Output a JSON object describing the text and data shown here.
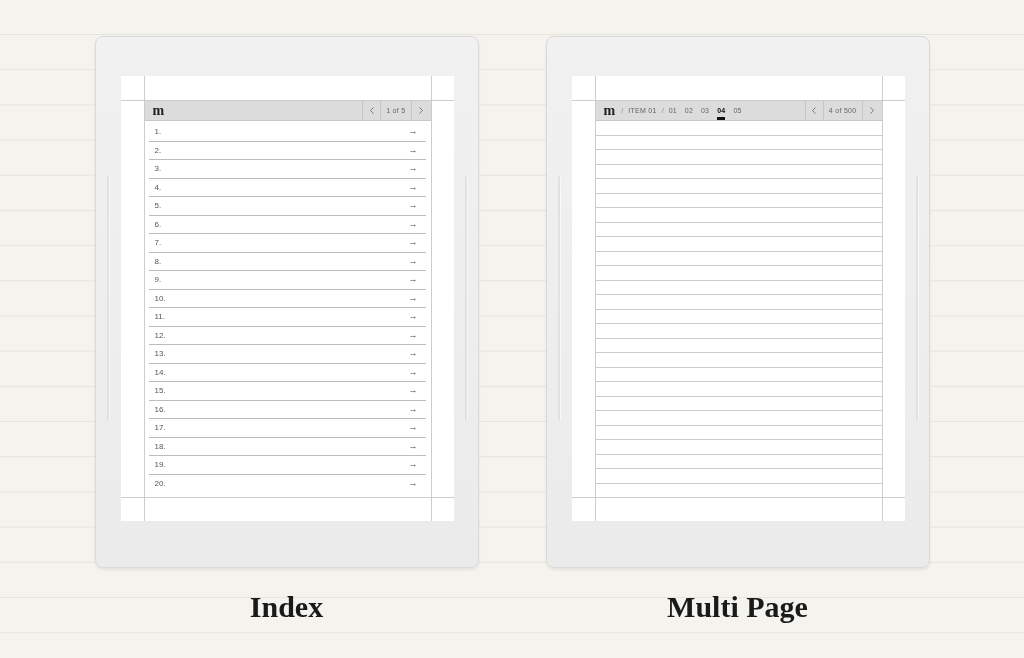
{
  "devices": [
    {
      "kind": "index",
      "header": {
        "logo": "m",
        "page_counter": "1 of 5"
      },
      "rows": [
        {
          "number": "1.",
          "arrow": "→"
        },
        {
          "number": "2.",
          "arrow": "→"
        },
        {
          "number": "3.",
          "arrow": "→"
        },
        {
          "number": "4.",
          "arrow": "→"
        },
        {
          "number": "5.",
          "arrow": "→"
        },
        {
          "number": "6.",
          "arrow": "→"
        },
        {
          "number": "7.",
          "arrow": "→"
        },
        {
          "number": "8.",
          "arrow": "→"
        },
        {
          "number": "9.",
          "arrow": "→"
        },
        {
          "number": "10.",
          "arrow": "→"
        },
        {
          "number": "11.",
          "arrow": "→"
        },
        {
          "number": "12.",
          "arrow": "→"
        },
        {
          "number": "13.",
          "arrow": "→"
        },
        {
          "number": "14.",
          "arrow": "→"
        },
        {
          "number": "15.",
          "arrow": "→"
        },
        {
          "number": "16.",
          "arrow": "→"
        },
        {
          "number": "17.",
          "arrow": "→"
        },
        {
          "number": "18.",
          "arrow": "→"
        },
        {
          "number": "19.",
          "arrow": "→"
        },
        {
          "number": "20.",
          "arrow": "→"
        }
      ],
      "caption": "Index"
    },
    {
      "kind": "multipage",
      "header": {
        "logo": "m",
        "breadcrumb": [
          {
            "kind": "separator",
            "text": "/"
          },
          {
            "kind": "link",
            "text": "ITEM 01"
          },
          {
            "kind": "separator",
            "text": "/"
          }
        ],
        "pages": [
          {
            "label": "01",
            "selected": false
          },
          {
            "label": "02",
            "selected": false
          },
          {
            "label": "03",
            "selected": false
          },
          {
            "label": "04",
            "selected": true
          },
          {
            "label": "05",
            "selected": false
          }
        ],
        "page_counter": "4 of 500"
      },
      "caption": "Multi Page"
    }
  ]
}
